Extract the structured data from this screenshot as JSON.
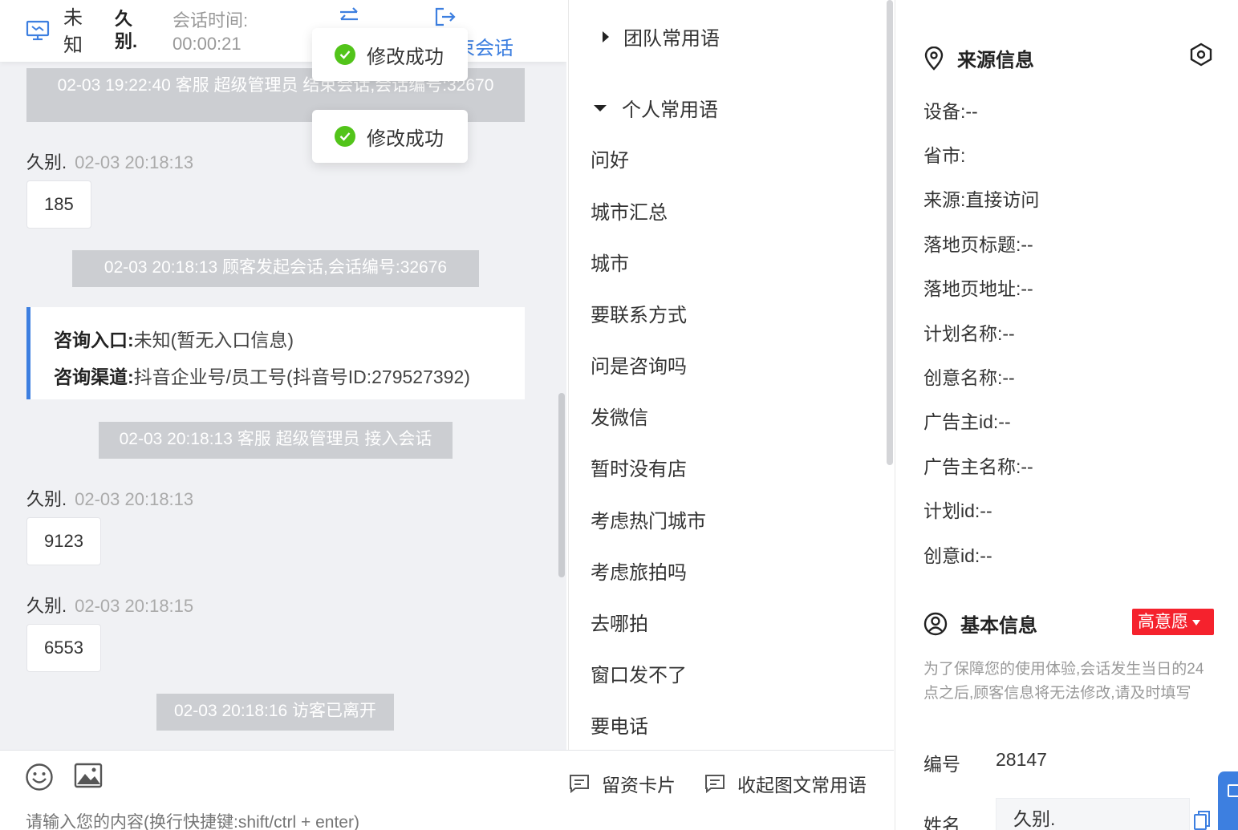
{
  "header": {
    "location": "未知",
    "visitor_name": "久别.",
    "session_time_label": "会话时间:",
    "session_time": "00:00:21",
    "end_session": "束会话"
  },
  "toasts": [
    "修改成功",
    "修改成功"
  ],
  "messages": {
    "sys1": "02-03 19:22:40 客服 超级管理员 结束会话,会话编号:32670",
    "m1_sender": "久别.",
    "m1_time": "02-03 20:18:13",
    "m1_text": "185",
    "sys2": "02-03 20:18:13 顾客发起会话,会话编号:32676",
    "info": {
      "entry_label": "咨询入口:",
      "entry_value": "未知(暂无入口信息)",
      "channel_label": "咨询渠道:",
      "channel_value": "抖音企业号/员工号(抖音号ID:279527392)"
    },
    "sys3": "02-03 20:18:13 客服 超级管理员 接入会话",
    "m2_sender": "久别.",
    "m2_time": "02-03 20:18:13",
    "m2_text": "9123",
    "m3_sender": "久别.",
    "m3_time": "02-03 20:18:15",
    "m3_text": "6553",
    "sys4": "02-03 20:18:16 访客已离开"
  },
  "phrases": {
    "team_group": "团队常用语",
    "personal_group": "个人常用语",
    "items": [
      "问好",
      "城市汇总",
      "城市",
      "要联系方式",
      "问是咨询吗",
      "发微信",
      "暂时没有店",
      "考虑热门城市",
      "考虑旅拍吗",
      "去哪拍",
      "窗口发不了",
      "要电话"
    ]
  },
  "composer": {
    "lead_card": "留资卡片",
    "fold_phrases": "收起图文常用语",
    "placeholder": "请输入您的内容(换行快捷键:shift/ctrl + enter)"
  },
  "source": {
    "title": "来源信息",
    "fields": [
      "设备:--",
      "省市:",
      "来源:直接访问",
      "落地页标题:--",
      "落地页地址:--",
      "计划名称:--",
      "创意名称:--",
      "广告主id:--",
      "广告主名称:--",
      "计划id:--",
      "创意id:--"
    ]
  },
  "basic": {
    "title": "基本信息",
    "intent_badge": "高意愿",
    "notice": "为了保障您的使用体验,会话发生当日的24点之后,顾客信息将无法修改,请及时填写",
    "id_label": "编号",
    "id_value": "28147",
    "name_label": "姓名",
    "name_value": "久别."
  },
  "colors": {
    "accent": "#3d7fe0",
    "success": "#52c41a",
    "badge": "#f5222d"
  }
}
